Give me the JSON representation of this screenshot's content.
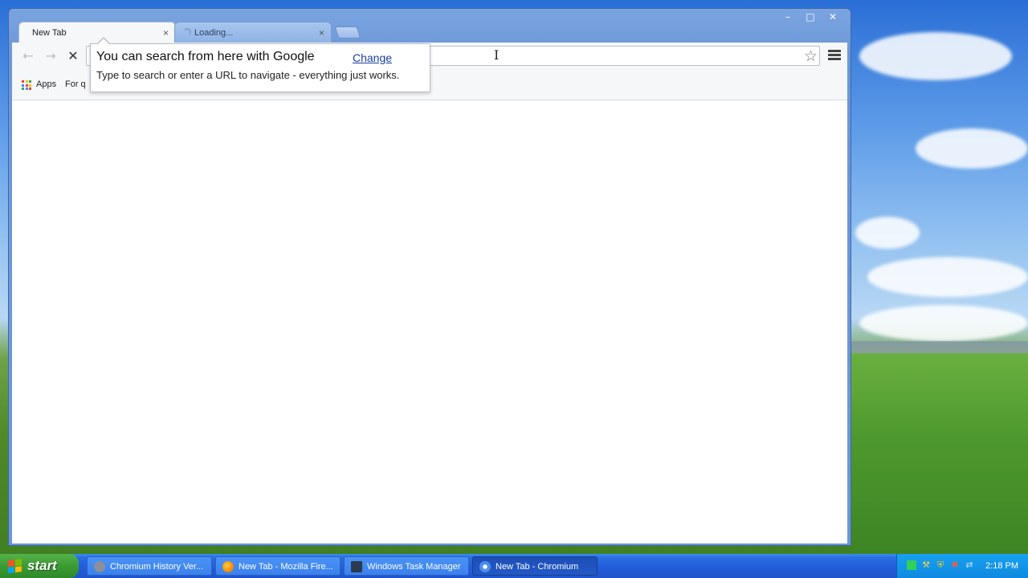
{
  "browser": {
    "window_controls": {
      "minimize": "–",
      "maximize": "□",
      "close": "✕"
    },
    "tabs": [
      {
        "title": "New Tab",
        "close": "×"
      },
      {
        "title": "Loading...",
        "close": "×"
      }
    ],
    "omnibox": {
      "value": "",
      "placeholder": ""
    },
    "bookmarks_bar": {
      "apps_label": "Apps",
      "other_label": "For q"
    },
    "search_bubble": {
      "title": "You can search from here with Google",
      "change_link": "Change",
      "subtitle": "Type to search or enter a URL to navigate - everything just works."
    }
  },
  "taskbar": {
    "start_label": "start",
    "tasks": [
      {
        "label": "Chromium History Ver...",
        "active": false
      },
      {
        "label": "New Tab - Mozilla Fire...",
        "active": false
      },
      {
        "label": "Windows Task Manager",
        "active": false
      },
      {
        "label": "New Tab - Chromium",
        "active": true
      }
    ],
    "clock": "2:18 PM"
  },
  "icons": {
    "back": "back-arrow-icon",
    "forward": "forward-arrow-icon",
    "stop": "stop-x-icon",
    "search": "magnifier-icon",
    "star": "bookmark-star-icon",
    "menu": "hamburger-menu-icon",
    "apps": "apps-grid-icon"
  },
  "colors": {
    "xp_taskbar": "#245edb",
    "start_green": "#3b9b33",
    "link_blue": "#1a3f9c"
  }
}
